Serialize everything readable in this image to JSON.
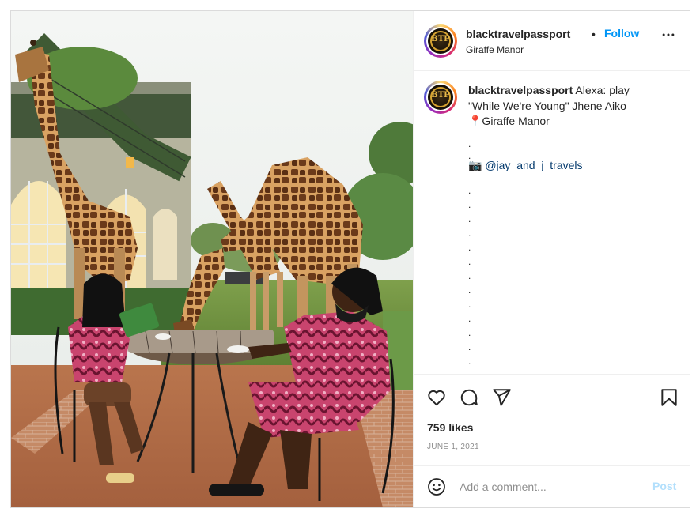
{
  "post": {
    "username": "blacktravelpassport",
    "separator": "•",
    "follow_label": "Follow",
    "location": "Giraffe Manor",
    "more_label": "•••",
    "avatar_monogram": "BTP"
  },
  "caption": {
    "username": "blacktravelpassport",
    "line1": " Alexa: play",
    "line2": "\"While We're Young\" Jhene Aiko",
    "line3": "📍Giraffe Manor",
    "dot": ".",
    "credit_prefix": "📷 ",
    "credit_mention": "@jay_and_j_travels"
  },
  "actions": {
    "like_icon": "heart-icon",
    "comment_icon": "comment-icon",
    "share_icon": "share-icon",
    "save_icon": "bookmark-icon",
    "likes": "759 likes",
    "date": "JUNE 1, 2021"
  },
  "comment": {
    "emoji_icon": "emoji-icon",
    "placeholder": "Add a comment...",
    "post_label": "Post"
  },
  "colors": {
    "link_blue": "#0095f6",
    "mention_blue": "#00376b",
    "muted": "#8e8e8e",
    "post_disabled": "#b2dffc"
  }
}
